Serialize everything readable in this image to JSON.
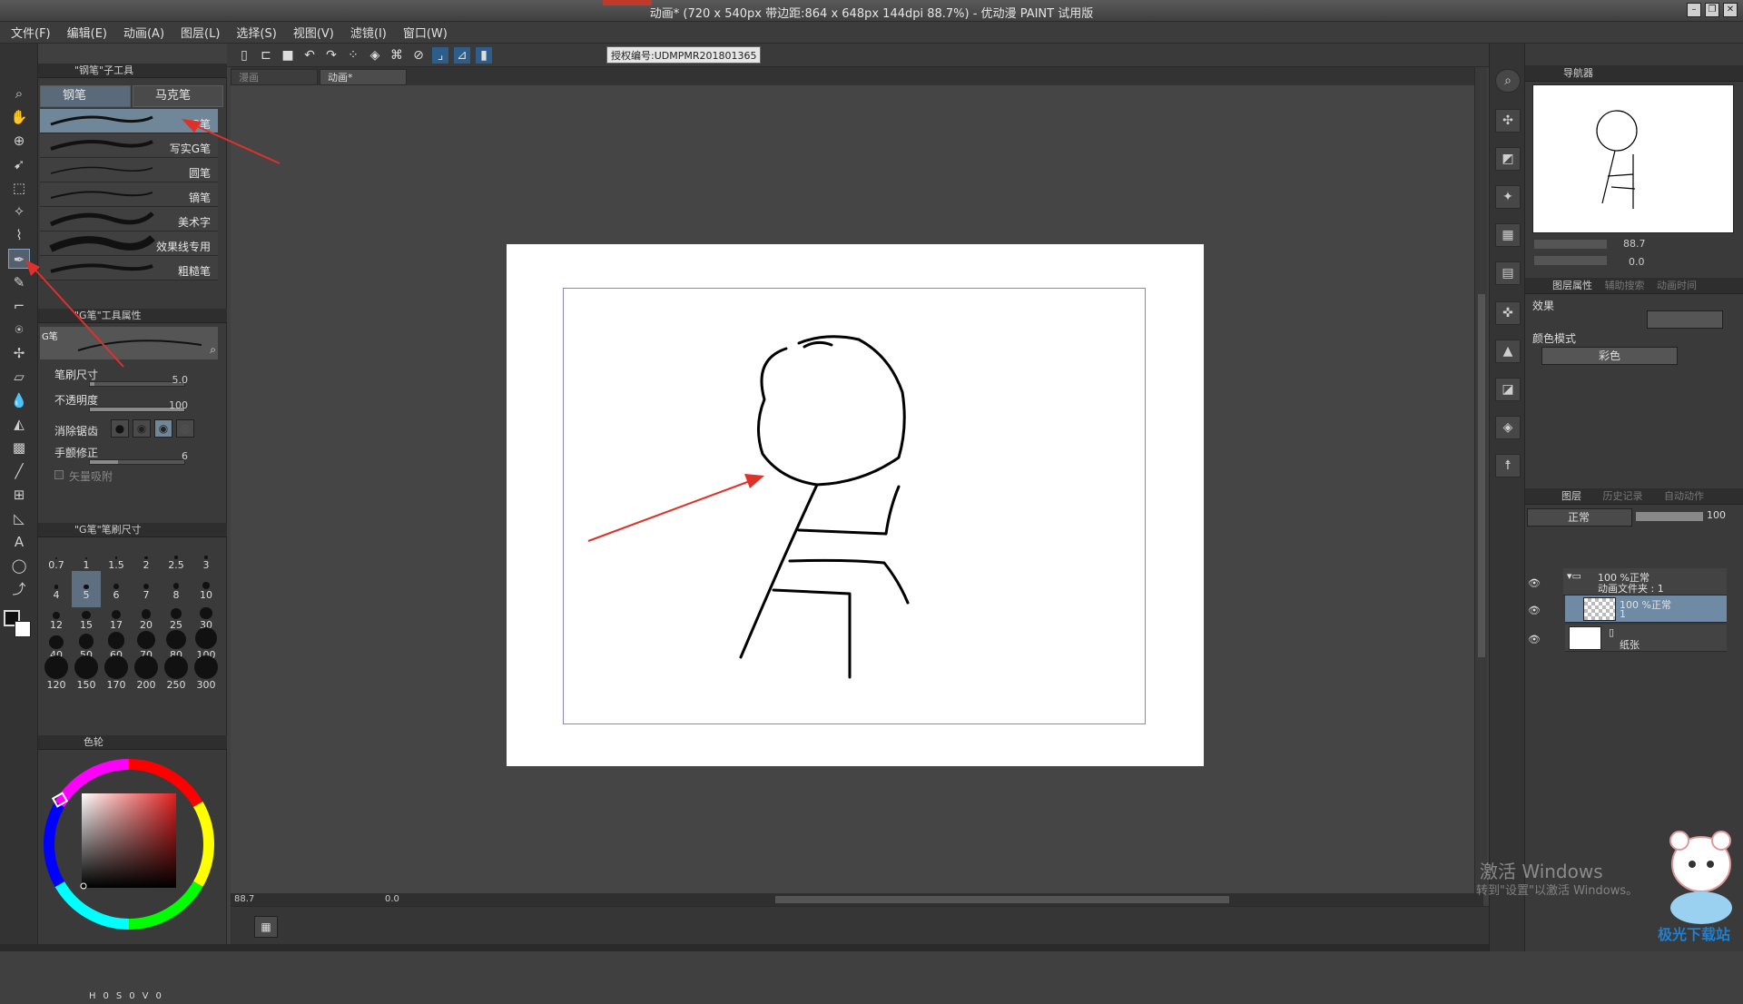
{
  "window": {
    "title": "动画* (720 x 540px 带边距:864 x 648px 144dpi 88.7%) - 优动漫 PAINT 试用版"
  },
  "menu": [
    "文件(F)",
    "编辑(E)",
    "动画(A)",
    "图层(L)",
    "选择(S)",
    "视图(V)",
    "滤镜(I)",
    "窗口(W)"
  ],
  "toolbar": {
    "license": "授权编号:UDMPMR201801365"
  },
  "pen_panel": {
    "header": "\"钢笔\"子工具",
    "tabs": [
      "钢笔",
      "马克笔"
    ],
    "brushes": [
      "G笔",
      "写实G笔",
      "圆笔",
      "镝笔",
      "美术字",
      "效果线专用",
      "粗糙笔"
    ]
  },
  "tool_props": {
    "header": "\"G笔\"工具属性",
    "preview_label": "G笔",
    "brush_size_label": "笔刷尺寸",
    "brush_size_value": "5.0",
    "brush_size_frac": 0.05,
    "opacity_label": "不透明度",
    "opacity_value": "100",
    "opacity_frac": 1.0,
    "antialias_label": "消除锯齿",
    "stabilizer_label": "手颤修正",
    "stabilizer_value": "6",
    "stabilizer_frac": 0.3,
    "vector_label": "矢量吸附"
  },
  "brush_sizes": {
    "header": "\"G笔\"笔刷尺寸",
    "values": [
      "0.7",
      "1",
      "1.5",
      "2",
      "2.5",
      "3",
      "4",
      "5",
      "6",
      "7",
      "8",
      "10",
      "12",
      "15",
      "17",
      "20",
      "25",
      "30",
      "40",
      "50",
      "60",
      "70",
      "80",
      "100",
      "120",
      "150",
      "170",
      "200",
      "250",
      "300"
    ],
    "selected": "5"
  },
  "color_panel": {
    "tab_label": "色轮",
    "hsv": [
      "H",
      "0",
      "S",
      "0",
      "V",
      "0"
    ]
  },
  "doc_tabs": [
    "漫画",
    "动画*"
  ],
  "status": {
    "zoom": "88.7",
    "rotation": "0.0"
  },
  "navigator": {
    "header": "导航器",
    "zoom": "88.7",
    "rotation": "0.0"
  },
  "layer_props": {
    "tabs": [
      "图层属性",
      "辅助搜索",
      "动画时间"
    ],
    "effect_label": "效果",
    "color_mode_label": "颜色模式",
    "color_mode_value": "彩色"
  },
  "layers_panel": {
    "tabs": [
      "图层",
      "历史记录",
      "自动动作"
    ],
    "blend_mode": "正常",
    "opacity": "100",
    "layers": [
      {
        "line1": "100 %正常",
        "line2": "动画文件夹 : 1"
      },
      {
        "line1": "100 %正常",
        "line2": "1"
      },
      {
        "line1": "",
        "line2": "纸张"
      }
    ]
  },
  "watermark": {
    "line1": "激活 Windows",
    "line2": "转到\"设置\"以激活 Windows。",
    "logo_text": "极光下载站"
  },
  "colors": {
    "accent_red": "#e0302a",
    "selection_blue": "#6f8799"
  }
}
